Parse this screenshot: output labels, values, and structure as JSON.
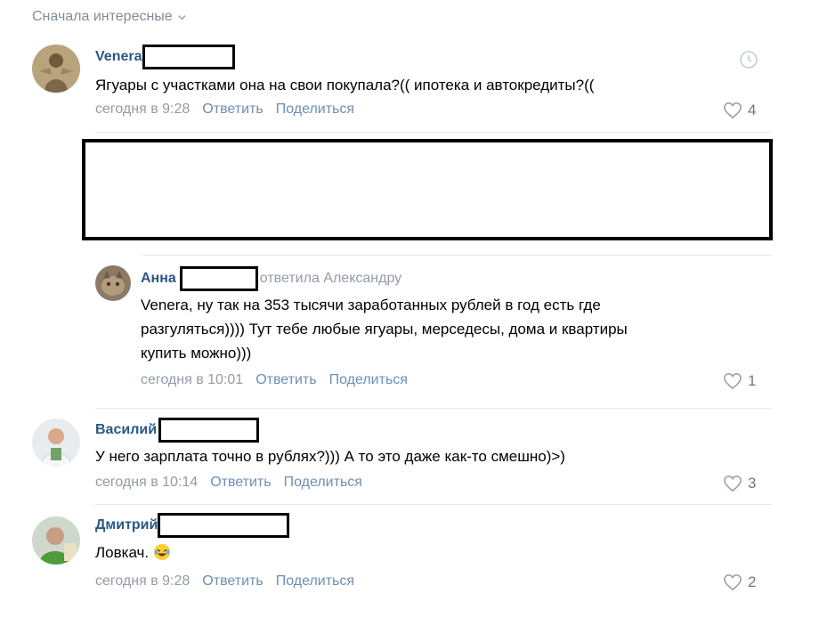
{
  "sort_label": "Сначала интересные",
  "comments": [
    {
      "author": "Venera",
      "text": "Ягуары с участками она на свои покупала?(( ипотека и автокредиты?((",
      "date": "сегодня в 9:28",
      "reply": "Ответить",
      "share": "Поделиться",
      "likes": "4"
    },
    {
      "author": "Анна",
      "reply_to": "ответила Александру",
      "text_lines": [
        "Venera, ну так на 353 тысячи заработанных рублей в год есть где",
        "разгуляться)))) Тут тебе любые ягуары, мерседесы, дома и квартиры",
        "купить можно)))"
      ],
      "date": "сегодня в 10:01",
      "reply": "Ответить",
      "share": "Поделиться",
      "likes": "1"
    },
    {
      "author": "Василий",
      "text": "У него зарплата точно в рублях?))) А то это даже как-то смешно)>)",
      "date": "сегодня в 10:14",
      "reply": "Ответить",
      "share": "Поделиться",
      "likes": "3"
    },
    {
      "author": "Дмитрий",
      "text": "Ловкач.",
      "date": "сегодня в 9:28",
      "reply": "Ответить",
      "share": "Поделиться",
      "likes": "2"
    }
  ],
  "icons": {
    "like": "heart-outline-icon",
    "sort": "chevron-down-icon",
    "time": "clock-icon",
    "emoji": "laughing-tears-emoji"
  },
  "colors": {
    "author": "#2a5885",
    "meta": "#939ba6",
    "divider": "#e7e8ec",
    "redaction": "#000000"
  }
}
